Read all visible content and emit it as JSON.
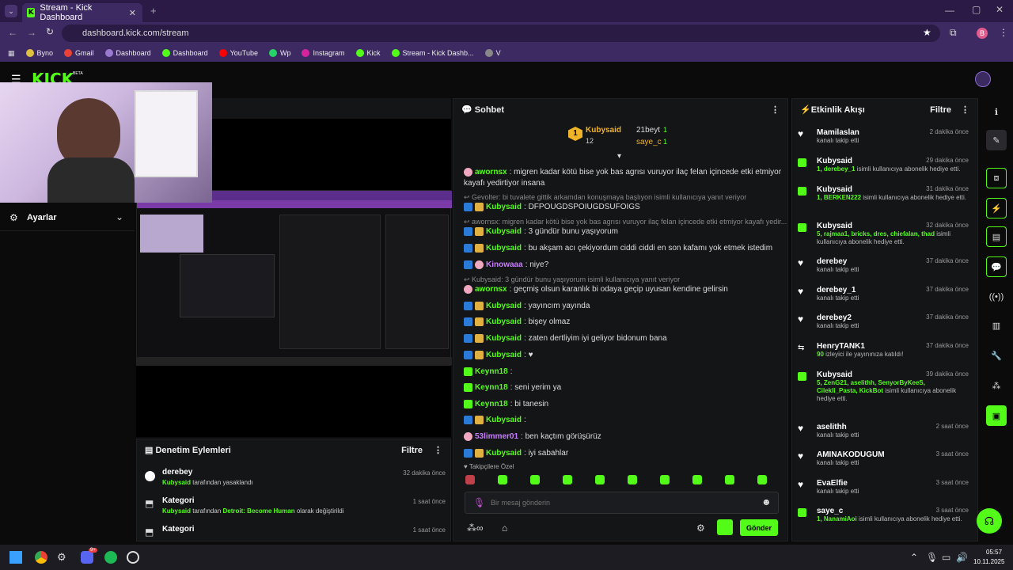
{
  "browser": {
    "tab_title": "Stream - Kick Dashboard",
    "url": "dashboard.kick.com/stream",
    "bookmarks": [
      "Byno",
      "Gmail",
      "Dashboard",
      "Dashboard",
      "YouTube",
      "Wp",
      "Instagram",
      "Kick",
      "Stream - Kick Dashb...",
      "V"
    ],
    "profile_initial": "B"
  },
  "header": {
    "logo": "KICK",
    "beta": "BETA"
  },
  "left": {
    "stream_title_partial": "i",
    "settings_label": "Ayarlar"
  },
  "moderation": {
    "title": "Denetim Eylemleri",
    "filter": "Filtre",
    "items": [
      {
        "name": "derebey",
        "time": "32 dakika önce",
        "actor": "Kubysaid",
        "text": " tarafından yasaklandı",
        "extra": ""
      },
      {
        "name": "Kategori",
        "time": "1 saat önce",
        "actor": "Kubysaid",
        "text": " tarafından ",
        "extra": "Detroit: Become Human",
        "tail": " olarak değiştirildi"
      },
      {
        "name": "Kategori",
        "time": "1 saat önce",
        "actor": "",
        "text": "",
        "extra": ""
      }
    ]
  },
  "chat": {
    "title": "Sohbet",
    "pinned": {
      "top_user": "Kubysaid",
      "top_count": "12",
      "r1": "21beyt",
      "r1n": "1",
      "r2": "saye_c",
      "r2n": "1"
    },
    "messages": [
      {
        "type": "msg",
        "user": "awornsx",
        "color": "#53fc18",
        "badges": "p",
        "text": ": migren kadar kötü bise yok bas agrısı vuruyor ilaç felan içincede etki etmiyor"
      },
      {
        "type": "cont",
        "text": "kayafı yedirtiyor insana"
      },
      {
        "type": "reply",
        "text": "Gevolter: bi tuvalete gittik arkamdan konuşmaya başlıyon isimli kullanıcıya yanıt veriyor"
      },
      {
        "type": "msg",
        "user": "Kubysaid",
        "color": "#53fc18",
        "badges": "by",
        "text": ": DFPOUGDSPOIUGDSUFOIGS"
      },
      {
        "type": "reply",
        "text": "awornsx: migren kadar kötü bise yok bas agrısı vuruyor ilaç felan içincede etki etmiyor kayafı yedir..."
      },
      {
        "type": "msg",
        "user": "Kubysaid",
        "color": "#53fc18",
        "badges": "by",
        "text": ": 3 gündür bunu yaşıyorum"
      },
      {
        "type": "msg",
        "user": "Kubysaid",
        "color": "#53fc18",
        "badges": "by",
        "text": ": bu akşam acı çekiyordum ciddi ciddi en son kafamı yok etmek istedim"
      },
      {
        "type": "msg",
        "user": "Kinowaaa",
        "color": "#c87cff",
        "badges": "bp",
        "text": ": niye?"
      },
      {
        "type": "reply",
        "text": "Kubysaid: 3 gündür bunu yaşıyorum isimli kullanıcıya yanıt veriyor"
      },
      {
        "type": "msg",
        "user": "awornsx",
        "color": "#53fc18",
        "badges": "p",
        "text": ": geçmiş olsun karanlık bi odaya geçip uyusan kendine gelirsin"
      },
      {
        "type": "msg",
        "user": "Kubysaid",
        "color": "#53fc18",
        "badges": "by",
        "text": ": yayıncım yayında"
      },
      {
        "type": "msg",
        "user": "Kubysaid",
        "color": "#53fc18",
        "badges": "by",
        "text": ": bişey olmaz"
      },
      {
        "type": "msg",
        "user": "Kubysaid",
        "color": "#53fc18",
        "badges": "by",
        "text": ": zaten dertliyim iyi geliyor bidonum bana"
      },
      {
        "type": "msg",
        "user": "Kubysaid",
        "color": "#53fc18",
        "badges": "by",
        "text": ": ♥"
      },
      {
        "type": "msg",
        "user": "Keynn18",
        "color": "#53fc18",
        "badges": "g",
        "text": ":"
      },
      {
        "type": "msg",
        "user": "Keynn18",
        "color": "#53fc18",
        "badges": "g",
        "text": ": seni yerim ya"
      },
      {
        "type": "msg",
        "user": "Keynn18",
        "color": "#53fc18",
        "badges": "g",
        "text": ": bi tanesin"
      },
      {
        "type": "msg",
        "user": "Kubysaid",
        "color": "#53fc18",
        "badges": "by",
        "text": ":"
      },
      {
        "type": "msg",
        "user": "53limmer01",
        "color": "#c87cff",
        "badges": "p",
        "text": ": ben kaçtım görüşürüz"
      },
      {
        "type": "msg",
        "user": "Kubysaid",
        "color": "#53fc18",
        "badges": "by",
        "text": ": iyi sabahlar"
      }
    ],
    "emote_tab": "Takipçilere Özel",
    "input_placeholder": "Bir mesaj gönderin",
    "send": "Gönder"
  },
  "activity": {
    "title": "Etkinlik Akışı",
    "filter": "Filtre",
    "items": [
      {
        "icon": "heart",
        "name": "Mamilaslan",
        "time": "2 dakika önce",
        "hl": "",
        "text": "kanalı takip etti"
      },
      {
        "icon": "gift",
        "name": "Kubysaid",
        "time": "29 dakika önce",
        "hl": "1, derebey_1",
        "text": " isimli kullanıcıya abonelik hediye etti."
      },
      {
        "icon": "gift",
        "name": "Kubysaid",
        "time": "31 dakika önce",
        "hl": "1, BERKEN222",
        "text": " isimli kullanıcıya abonelik hediye etti."
      },
      {
        "icon": "gift",
        "name": "Kubysaid",
        "time": "32 dakika önce",
        "hl": "5, rajmaa1, bricks, dres, chiefalan, thad",
        "text": " isimli kullanıcıya abonelik hediye etti."
      },
      {
        "icon": "heart",
        "name": "derebey",
        "time": "37 dakika önce",
        "hl": "",
        "text": "kanalı takip etti"
      },
      {
        "icon": "heart",
        "name": "derebey_1",
        "time": "37 dakika önce",
        "hl": "",
        "text": "kanalı takip etti"
      },
      {
        "icon": "heart",
        "name": "derebey2",
        "time": "37 dakika önce",
        "hl": "",
        "text": "kanalı takip etti"
      },
      {
        "icon": "host",
        "name": "HenryTANK1",
        "time": "37 dakika önce",
        "hl": "90",
        "text": " izleyici ile yayınınıza katıldı!"
      },
      {
        "icon": "gift",
        "name": "Kubysaid",
        "time": "39 dakika önce",
        "hl": "5, ZenG21, aselithh, SenyorByKeeS, Cilekli_Pasta, KickBot",
        "text": " isimli kullanıcıya abonelik hediye etti."
      },
      {
        "icon": "heart",
        "name": "aselithh",
        "time": "2 saat önce",
        "hl": "",
        "text": "kanalı takip etti"
      },
      {
        "icon": "heart",
        "name": "AMINAKODUGUM",
        "time": "3 saat önce",
        "hl": "",
        "text": "kanalı takip etti"
      },
      {
        "icon": "heart",
        "name": "EvaElfie",
        "time": "3 saat önce",
        "hl": "",
        "text": "kanalı takip etti"
      },
      {
        "icon": "gift",
        "name": "saye_c",
        "time": "3 saat önce",
        "hl": "1, NanamiAoi",
        "text": " isimli kullanıcıya abonelik hediye etti."
      }
    ]
  },
  "taskbar": {
    "time": "05:57",
    "date": "10.11.2025",
    "badge": "9+"
  },
  "colors": {
    "accent": "#53fc18",
    "bg": "#0b0b0c",
    "panel": "#141517",
    "chrome": "#3e2a63"
  }
}
